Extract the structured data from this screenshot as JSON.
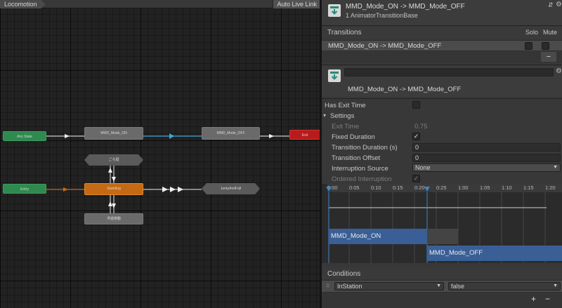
{
  "graph": {
    "layer_tab": "Locomotion",
    "auto_live_link": "Auto Live Link",
    "nodes": {
      "any_state": "Any State",
      "mmd_on": "MMD_Mode_ON",
      "mmd_off": "MMD_Mode_OFF",
      "exit": "Exit",
      "entry": "Entry",
      "standing": "Standing",
      "top": "ごろ寝",
      "jump": "JumpAndFall",
      "bottom": "浮遊移動"
    },
    "colors": {
      "grid_bg": "#222222",
      "default_state": "#c46a14",
      "any_state": "#2f8a4f",
      "exit": "#b81b1b",
      "selected_transition": "#3fa7d6"
    }
  },
  "inspector": {
    "header_title": "MMD_Mode_ON -> MMD_Mode_OFF",
    "header_subtitle": "1 AnimatorTransitionBase",
    "transitions_label": "Transitions",
    "solo_label": "Solo",
    "mute_label": "Mute",
    "transition_item": "MMD_Mode_ON -> MMD_Mode_OFF",
    "minus_label": "−",
    "name_field": "",
    "transition_name": "MMD_Mode_ON -> MMD_Mode_OFF",
    "has_exit_time_label": "Has Exit Time",
    "settings_label": "Settings",
    "exit_time_label": "Exit Time",
    "exit_time_value": "0.75",
    "fixed_duration_label": "Fixed Duration",
    "fixed_duration_check": "✓",
    "transition_duration_label": "Transition Duration (s)",
    "transition_duration_value": "0",
    "transition_offset_label": "Transition Offset",
    "transition_offset_value": "0",
    "interruption_source_label": "Interruption Source",
    "interruption_source_value": "None",
    "ordered_interruption_label": "Ordered Interruption",
    "ordered_interruption_check": "✓",
    "timeline_ticks": [
      "0:00",
      "0:05",
      "0:10",
      "0:15",
      "0:20",
      "0:25",
      "1:00",
      "1:05",
      "1:10",
      "1:15",
      "1:20"
    ],
    "timeline_state_a": "MMD_Mode_ON",
    "timeline_state_b": "MMD_Mode_OFF",
    "conditions_label": "Conditions",
    "condition_param": "InStation",
    "condition_value": "false",
    "plus_label": "+",
    "minus2_label": "−",
    "colors": {
      "panel_bg": "#383838",
      "clip_bar": "#3a5f96",
      "playhead": "#3f86c9"
    }
  }
}
